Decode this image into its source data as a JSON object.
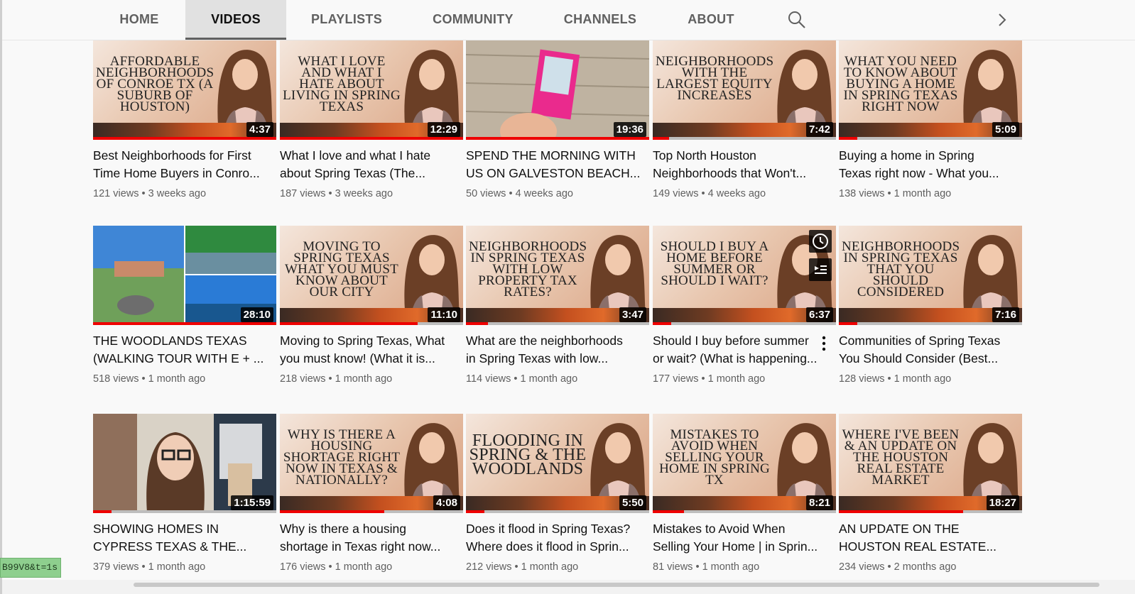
{
  "tabs": [
    {
      "label": "HOME",
      "active": false
    },
    {
      "label": "VIDEOS",
      "active": true
    },
    {
      "label": "PLAYLISTS",
      "active": false
    },
    {
      "label": "COMMUNITY",
      "active": false
    },
    {
      "label": "CHANNELS",
      "active": false
    },
    {
      "label": "ABOUT",
      "active": false
    }
  ],
  "icons": {
    "search": "search-icon",
    "next": "chevron-right-icon",
    "watch_later": "clock-icon",
    "add_to_queue": "queue-icon",
    "more": "more-vert-icon"
  },
  "colors": {
    "progress": "#ee0000",
    "duration_bg": "#000000",
    "status_pill": "#8ecf8e"
  },
  "status_url": "B99V8&t=1s",
  "videos": [
    {
      "thumb_text": "AFFORDABLE NEIGHBORHOODS OF CONROE TX (A SUBURB OF HOUSTON)",
      "duration": "4:37",
      "progress": 1.0,
      "title_line1": "Best Neighborhoods for First",
      "title_line2": "Time Home Buyers in Conro...",
      "views": "121 views",
      "age": "3 weeks ago"
    },
    {
      "thumb_text": "WHAT I LOVE AND WHAT I HATE ABOUT LIVING IN SPRING TEXAS",
      "duration": "12:29",
      "progress": 1.0,
      "title_line1": "What I love and what I hate",
      "title_line2": "about Spring Texas (The...",
      "views": "187 views",
      "age": "3 weeks ago"
    },
    {
      "thumb_text": "",
      "duration": "19:36",
      "progress": 1.0,
      "title_line1": "SPEND THE MORNING WITH",
      "title_line2": "US ON GALVESTON BEACH...",
      "views": "50 views",
      "age": "4 weeks ago"
    },
    {
      "thumb_text": "NEIGHBORHOODS WITH THE LARGEST EQUITY INCREASES",
      "duration": "7:42",
      "progress": 0.09,
      "title_line1": "Top North Houston",
      "title_line2": "Neighborhoods that Won't...",
      "views": "149 views",
      "age": "4 weeks ago"
    },
    {
      "thumb_text": "WHAT YOU NEED TO KNOW ABOUT BUYING A HOME IN SPRING TEXAS RIGHT NOW",
      "duration": "5:09",
      "progress": 0.1,
      "title_line1": "Buying a home in Spring",
      "title_line2": "Texas right now - What you...",
      "views": "138 views",
      "age": "1 month ago"
    },
    {
      "thumb_text": "",
      "duration": "28:10",
      "progress": 1.0,
      "title_line1": "THE WOODLANDS TEXAS",
      "title_line2": "(WALKING TOUR WITH E + ...",
      "views": "518 views",
      "age": "1 month ago"
    },
    {
      "thumb_text": "MOVING TO SPRING TEXAS WHAT YOU MUST KNOW ABOUT OUR CITY",
      "duration": "11:10",
      "progress": 0.75,
      "title_line1": "Moving to Spring Texas, What",
      "title_line2": "you must know! (What it is...",
      "views": "218 views",
      "age": "1 month ago"
    },
    {
      "thumb_text": "NEIGHBORHOODS IN SPRING TEXAS WITH LOW PROPERTY TAX RATES?",
      "duration": "3:47",
      "progress": 0.12,
      "title_line1": "What are the neighborhoods",
      "title_line2": "in Spring Texas with low...",
      "views": "114 views",
      "age": "1 month ago"
    },
    {
      "thumb_text": "SHOULD I BUY A HOME BEFORE SUMMER OR SHOULD I WAIT?",
      "duration": "6:37",
      "progress": 0.1,
      "title_line1": "Should I buy before summer",
      "title_line2": "or wait? (What is happening...",
      "views": "177 views",
      "age": "1 month ago"
    },
    {
      "thumb_text": "NEIGHBORHOODS IN SPRING TEXAS THAT YOU SHOULD CONSIDERED",
      "duration": "7:16",
      "progress": 0.1,
      "title_line1": "Communities of Spring Texas",
      "title_line2": "You Should Consider (Best...",
      "views": "128 views",
      "age": "1 month ago"
    },
    {
      "thumb_text": "",
      "duration": "1:15:59",
      "progress": 0.1,
      "title_line1": "SHOWING HOMES IN",
      "title_line2": "CYPRESS TEXAS & THE...",
      "views": "379 views",
      "age": "1 month ago"
    },
    {
      "thumb_text": "WHY IS THERE A HOUSING SHORTAGE RIGHT NOW IN TEXAS & NATIONALLY?",
      "duration": "4:08",
      "progress": 0.57,
      "title_line1": "Why is there a housing",
      "title_line2": "shortage in Texas right now...",
      "views": "176 views",
      "age": "1 month ago"
    },
    {
      "thumb_text": "FLOODING IN SPRING & THE WOODLANDS",
      "duration": "5:50",
      "progress": 0.1,
      "title_line1": "Does it flood in Spring Texas?",
      "title_line2": "Where does it flood in Sprin...",
      "views": "212 views",
      "age": "1 month ago"
    },
    {
      "thumb_text": "MISTAKES TO AVOID WHEN SELLING YOUR HOME IN SPRING TX",
      "duration": "8:21",
      "progress": 0.17,
      "title_line1": "Mistakes to Avoid When",
      "title_line2": "Selling Your Home | in Sprin...",
      "views": "81 views",
      "age": "1 month ago"
    },
    {
      "thumb_text": "WHERE I'VE BEEN & AN UPDATE ON THE HOUSTON REAL ESTATE MARKET",
      "duration": "18:27",
      "progress": 0.68,
      "title_line1": "AN UPDATE ON THE",
      "title_line2": "HOUSTON REAL ESTATE...",
      "views": "234 views",
      "age": "2 months ago"
    }
  ]
}
